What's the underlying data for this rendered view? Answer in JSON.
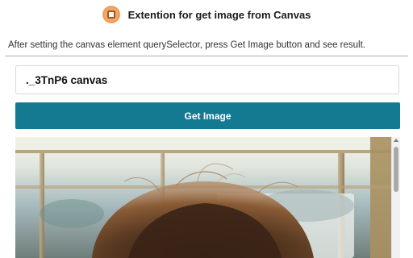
{
  "header": {
    "title": "Extention for get image from Canvas",
    "logo": "canvas-logo-icon"
  },
  "instructions": "After setting the canvas element querySelector, press Get Image button and see result.",
  "selector_input": {
    "value": "._3TnP6 canvas"
  },
  "get_image_button": {
    "label": "Get Image"
  },
  "result_image": {
    "description_icon": "photo-image"
  },
  "colors": {
    "button": "#147a92",
    "divider": "#e1e1e1"
  }
}
